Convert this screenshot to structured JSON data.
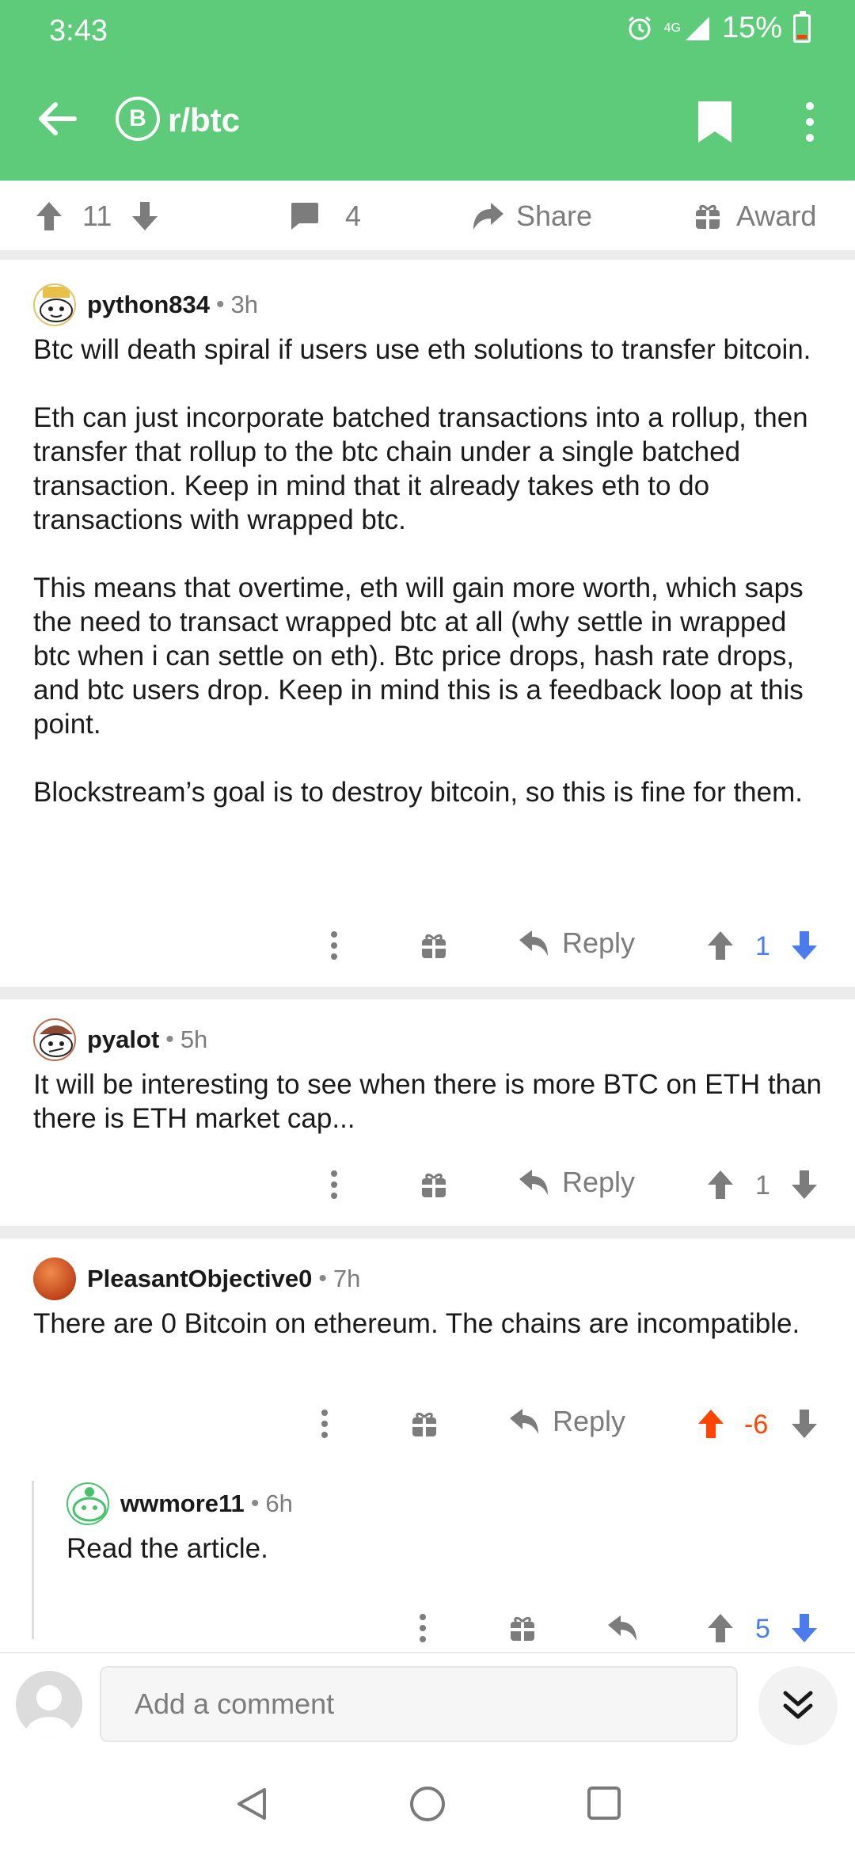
{
  "status_bar": {
    "time": "3:43",
    "network": "4G",
    "battery": "15%"
  },
  "app_bar": {
    "subreddit": "r/btc",
    "sub_icon_letter": "B"
  },
  "post_actions": {
    "upvotes": "11",
    "comments": "4",
    "share_label": "Share",
    "award_label": "Award"
  },
  "comments": [
    {
      "username": "python834",
      "age": "3h",
      "paragraphs": [
        "Btc will death spiral if users use eth solutions to transfer bitcoin.",
        "Eth can just incorporate batched transactions into a rollup, then transfer that rollup to the btc chain under a single batched transaction. Keep in mind that it already takes eth to do transactions with wrapped btc.",
        "This means that overtime, eth will gain more worth, which saps the need to transact wrapped btc at all (why settle in wrapped btc when i can settle on eth). Btc price drops, hash rate drops, and btc users drop. Keep in mind this is a feedback loop at this point.",
        "Blockstream’s goal is to destroy bitcoin, so this is fine for them."
      ],
      "reply_label": "Reply",
      "score": "1",
      "vote_state": "downvoted",
      "score_color": "#4a7cf0"
    },
    {
      "username": "pyalot",
      "age": "5h",
      "paragraphs": [
        "It will be interesting to see when there is more BTC on ETH than there is ETH market cap..."
      ],
      "reply_label": "Reply",
      "score": "1",
      "vote_state": "none",
      "score_color": "#7c7c7c"
    },
    {
      "username": "PleasantObjective0",
      "age": "7h",
      "paragraphs": [
        "There are 0 Bitcoin on ethereum.  The chains are incompatible."
      ],
      "reply_label": "Reply",
      "score": "-6",
      "vote_state": "upvoted",
      "score_color": "#ff4500"
    },
    {
      "username": "wwmore11",
      "age": "6h",
      "paragraphs": [
        "Read the article."
      ],
      "score": "5",
      "vote_state": "downvoted",
      "score_color": "#4a7cf0"
    }
  ],
  "composer": {
    "placeholder": "Add a comment"
  },
  "colors": {
    "brand": "#5ecb7a",
    "upvote": "#ff4500",
    "downvote": "#4a7cf0"
  }
}
